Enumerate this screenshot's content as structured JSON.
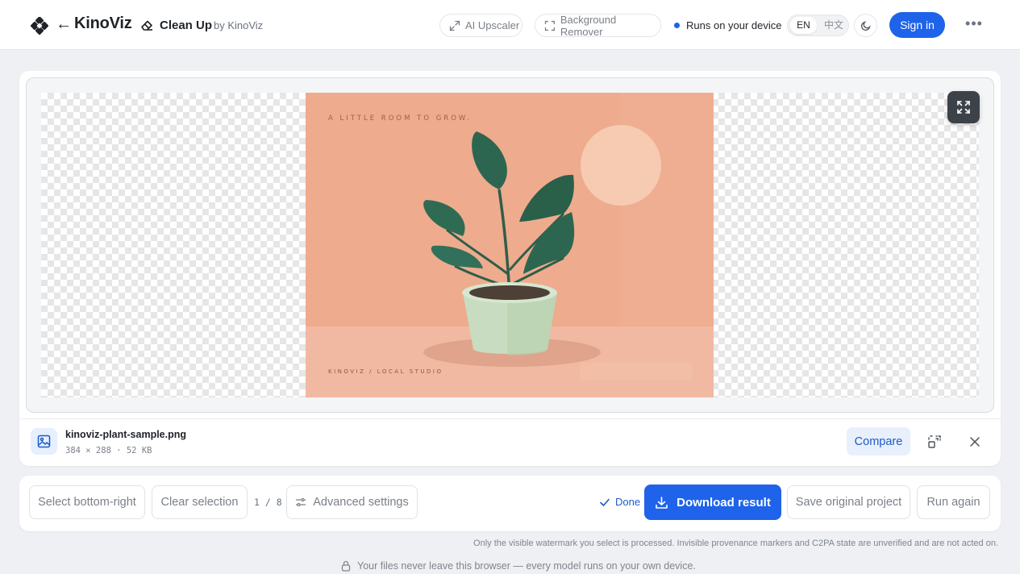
{
  "header": {
    "brand": "KinoViz",
    "back_arrow": "←",
    "tool_name": "Clean Up",
    "tool_by": "by KinoViz",
    "tool_icon": "eraser-icon",
    "links": [
      {
        "label": "AI Upscaler",
        "icon": "expand-arrows-icon"
      },
      {
        "label": "Background Remover",
        "icon": "dashed-frame-icon"
      }
    ],
    "device_status": "Runs on your device",
    "status_color": "#1e63e9",
    "languages": {
      "active": "EN",
      "other": "中文"
    },
    "theme_icon": "moon-icon",
    "signin_label": "Sign in",
    "more_label": "•••"
  },
  "canvas": {
    "artwork": {
      "headline": "A LITTLE ROOM TO GROW.",
      "footer": "KINOVIZ / LOCAL STUDIO"
    },
    "fullscreen_icon": "fullscreen-icon"
  },
  "file": {
    "name": "kinoviz-plant-sample.png",
    "meta": "384 × 288 · 52 KB",
    "compare_label": "Compare"
  },
  "actions": {
    "select_label": "Select bottom-right",
    "clear_label": "Clear selection",
    "counter": "1 / 8",
    "advanced_label": "Advanced settings",
    "done_label": "Done",
    "download_label": "Download result",
    "save_label": "Save original project",
    "run_label": "Run again"
  },
  "notes": {
    "watermark": "Only the visible watermark you select is processed. Invisible provenance markers and C2PA state are unverified and are not acted on.",
    "privacy": "Your files never leave this browser — every model runs on your own device."
  },
  "colors": {
    "accent": "#1e63e9",
    "artwork_bg": "#efad8f"
  }
}
